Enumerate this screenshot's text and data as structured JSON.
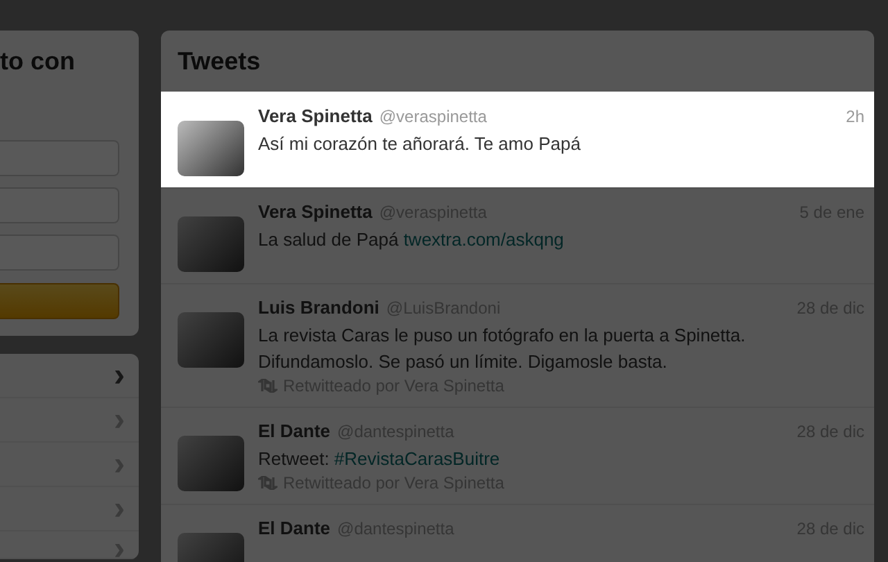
{
  "side_panel": {
    "heading": "to con",
    "fields": [
      {
        "kind": "field"
      },
      {
        "kind": "field"
      },
      {
        "kind": "field"
      }
    ],
    "button": {
      "kind": "button"
    }
  },
  "side_menu": {
    "rows": [
      {
        "chevron": "›"
      },
      {
        "chevron": "›"
      },
      {
        "chevron": "›"
      },
      {
        "chevron": "›"
      },
      {
        "chevron": "›"
      }
    ]
  },
  "tweets": {
    "title": "Tweets",
    "items": [
      {
        "name": "Vera Spinetta",
        "handle": "@veraspinetta",
        "time": "2h",
        "highlighted": true,
        "text": [
          {
            "kind": "plain",
            "text": "Así mi corazón te añorará. Te amo Papá"
          }
        ]
      },
      {
        "name": "Vera Spinetta",
        "handle": "@veraspinetta",
        "time": "5 de ene",
        "highlighted": false,
        "text": [
          {
            "kind": "plain",
            "text": "La salud de Papá "
          },
          {
            "kind": "link",
            "text": "twextra.com/askqng"
          }
        ]
      },
      {
        "name": "Luis Brandoni",
        "handle": "@LuisBrandoni",
        "time": "28 de dic",
        "highlighted": false,
        "text": [
          {
            "kind": "plain",
            "text": "La revista Caras le puso un fotógrafo en la puerta a Spinetta. Difundamoslo. Se pasó un límite. Digamosle basta."
          }
        ],
        "retweeted_by": "Retwitteado por Vera Spinetta"
      },
      {
        "name": "El Dante",
        "handle": "@dantespinetta",
        "time": "28 de dic",
        "highlighted": false,
        "text": [
          {
            "kind": "plain",
            "text": "Retweet: "
          },
          {
            "kind": "link",
            "text": "#RevistaCarasBuitre"
          }
        ],
        "retweeted_by": "Retwitteado por Vera Spinetta"
      },
      {
        "name": "El Dante",
        "handle": "@dantespinetta",
        "time": "28 de dic",
        "highlighted": false
      }
    ]
  }
}
